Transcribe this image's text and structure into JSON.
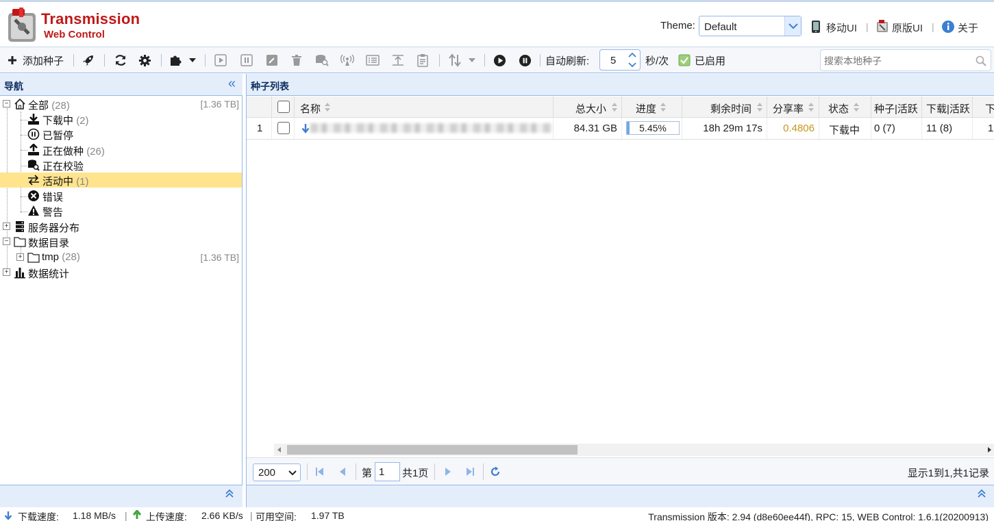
{
  "header": {
    "logo_title": "Transmission",
    "logo_sub": "Web Control",
    "theme_label": "Theme:",
    "theme_value": "Default",
    "mobile_ui": "移动UI",
    "original_ui": "原版UI",
    "about": "关于",
    "separator": "|"
  },
  "toolbar": {
    "add_torrent": "添加种子",
    "auto_refresh_label": "自动刷新:",
    "refresh_interval": "5",
    "refresh_unit": "秒/次",
    "enabled_label": "已启用",
    "search_placeholder": "搜索本地种子"
  },
  "nav": {
    "title": "导航",
    "items": [
      {
        "label": "全部",
        "count": "(28)",
        "size": "[1.36 TB]"
      },
      {
        "label": "下载中",
        "count": "(2)"
      },
      {
        "label": "已暂停",
        "count": ""
      },
      {
        "label": "正在做种",
        "count": "(26)"
      },
      {
        "label": "正在校验",
        "count": ""
      },
      {
        "label": "活动中",
        "count": "(1)"
      },
      {
        "label": "错误",
        "count": ""
      },
      {
        "label": "警告",
        "count": ""
      },
      {
        "label": "服务器分布",
        "count": ""
      },
      {
        "label": "数据目录",
        "count": ""
      },
      {
        "label": "tmp",
        "count": "(28)",
        "size": "[1.36 TB]"
      },
      {
        "label": "数据统计",
        "count": ""
      }
    ]
  },
  "list": {
    "title": "种子列表",
    "columns": [
      "名称",
      "总大小",
      "进度",
      "剩余时间",
      "分享率",
      "状态",
      "种子|活跃",
      "下载|活跃",
      "下"
    ],
    "rows": [
      {
        "index": "1",
        "size": "84.31 GB",
        "progress": "5.45%",
        "progress_value": 5.45,
        "remaining": "18h 29m 17s",
        "ratio": "0.4806",
        "status": "下载中",
        "seeds": "0 (7)",
        "peers": "11 (8)",
        "extra": "1"
      }
    ],
    "colors": {
      "ratio": "#c8961e",
      "progress_fill": "#6fa8e8"
    }
  },
  "pager": {
    "page_size": "200",
    "page_prefix": "第",
    "page_value": "1",
    "page_total": "共1页",
    "summary": "显示1到1,共1记录"
  },
  "status": {
    "download_label": "下载速度:",
    "download_value": "1.18 MB/s",
    "upload_label": "上传速度:",
    "upload_value": "2.66 KB/s",
    "space_label": "可用空间:",
    "space_value": "1.97 TB",
    "version": "Transmission 版本: 2.94 (d8e60ee44f), RPC: 15, WEB Control: 1.6.1(20200913)"
  }
}
